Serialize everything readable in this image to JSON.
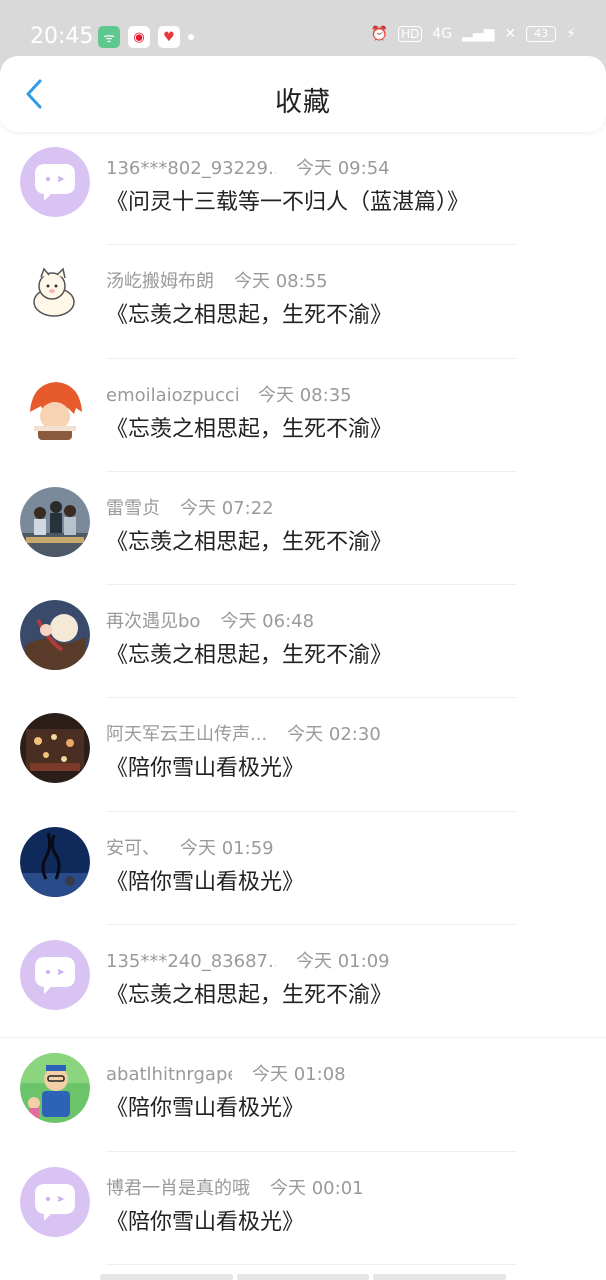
{
  "status_bar": {
    "time": "20:45",
    "network": "4G",
    "hd": "HD",
    "battery": "43"
  },
  "header": {
    "title": "收藏"
  },
  "favorites": [
    {
      "user": "136***802_93229...",
      "time": "今天 09:54",
      "work": "《问灵十三载等一不归人（蓝湛篇）》",
      "avatar": "default-bubble"
    },
    {
      "user": "汤屹搬姆布朗",
      "time": "今天 08:55",
      "work": "《忘羡之相思起，生死不渝》",
      "avatar": "cat"
    },
    {
      "user": "emoilaiozpucci",
      "time": "今天 08:35",
      "work": "《忘羡之相思起，生死不渝》",
      "avatar": "redhair-anime"
    },
    {
      "user": "雷雪贞",
      "time": "今天 07:22",
      "work": "《忘羡之相思起，生死不渝》",
      "avatar": "group-photo"
    },
    {
      "user": "再次遇见bo",
      "time": "今天 06:48",
      "work": "《忘羡之相思起，生死不渝》",
      "avatar": "anime-moon"
    },
    {
      "user": "阿天军云王山传声...",
      "time": "今天 02:30",
      "work": "《陪你雪山看极光》",
      "avatar": "lights"
    },
    {
      "user": "安可、",
      "time": "今天 01:59",
      "work": "《陪你雪山看极光》",
      "avatar": "night-sky"
    },
    {
      "user": "135***240_83687...",
      "time": "今天 01:09",
      "work": "《忘羡之相思起，生死不渝》",
      "avatar": "default-bubble"
    },
    {
      "user": "abatlhitnrgape",
      "time": "今天 01:08",
      "work": "《陪你雪山看极光》",
      "avatar": "cartoon-boy"
    },
    {
      "user": "博君一肖是真的哦",
      "time": "今天 00:01",
      "work": "《陪你雪山看极光》",
      "avatar": "default-bubble"
    }
  ],
  "colors": {
    "accent": "#2f9be9",
    "default_avatar": "#d9c3f3",
    "meta_text": "#9a9a9a",
    "title_text": "#222222"
  }
}
